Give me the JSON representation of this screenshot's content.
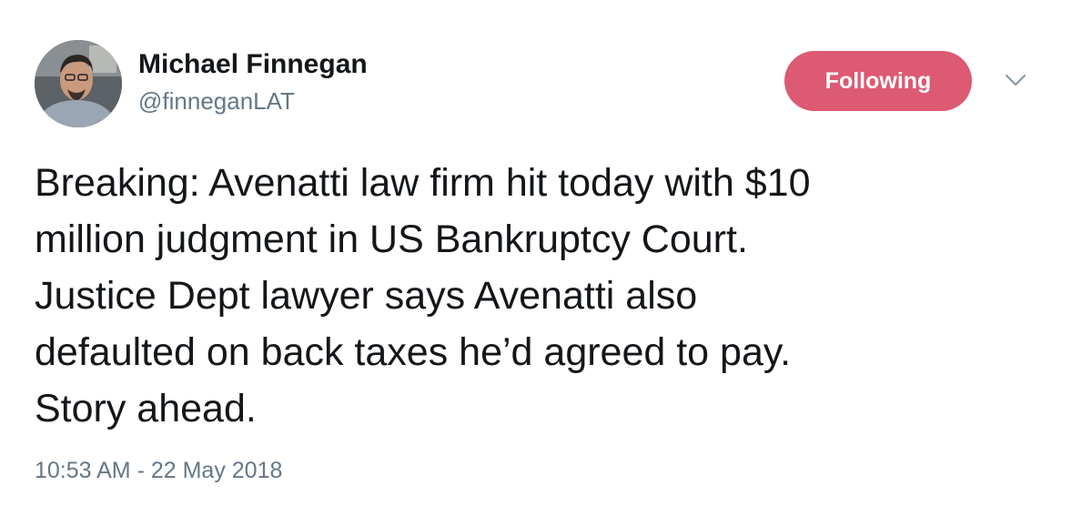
{
  "author": {
    "name": "Michael Finnegan",
    "handle": "@finneganLAT"
  },
  "follow_button": {
    "label": "Following",
    "color": "#dc5a72"
  },
  "menu": {
    "icon": "chevron-down-icon"
  },
  "tweet": {
    "lines": [
      "Breaking: Avenatti law firm hit today with $10",
      "million judgment in US Bankruptcy Court.",
      "Justice Dept lawyer says Avenatti also",
      "defaulted on back taxes he’d agreed to pay.",
      "Story ahead."
    ],
    "timestamp": "10:53 AM - 22 May 2018"
  }
}
